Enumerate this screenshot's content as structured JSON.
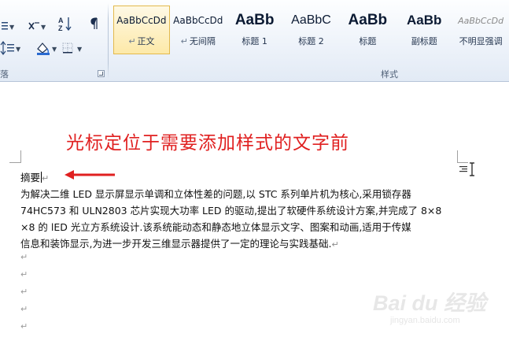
{
  "ribbon": {
    "paragraph_group_label": "落",
    "styles_group_label": "样式",
    "paragraph_tools": [
      {
        "name": "bullets-icon"
      },
      {
        "name": "text-direction-icon"
      },
      {
        "name": "sort-icon"
      },
      {
        "name": "show-formatting-marks-icon"
      },
      {
        "name": "line-spacing-icon"
      },
      {
        "name": "shading-icon"
      },
      {
        "name": "borders-icon"
      }
    ],
    "styles": [
      {
        "sample": "AaBbCcDd",
        "name": "正文",
        "mark": "↵",
        "selected": true
      },
      {
        "sample": "AaBbCcDd",
        "name": "无间隔",
        "mark": "↵",
        "selected": false
      },
      {
        "sample": "AaBb",
        "name": "标题 1",
        "mark": "",
        "selected": false
      },
      {
        "sample": "AaBbC",
        "name": "标题 2",
        "mark": "",
        "selected": false
      },
      {
        "sample": "AaBb",
        "name": "标题",
        "mark": "",
        "selected": false
      },
      {
        "sample": "AaBb",
        "name": "副标题",
        "mark": "",
        "selected": false
      },
      {
        "sample": "AaBbCcDd",
        "name": "不明显强调",
        "mark": "",
        "selected": false
      }
    ]
  },
  "document": {
    "annotation": "光标定位于需要添加样式的文字前",
    "heading_text": "摘要",
    "body_lines": [
      "为解决二维 LED 显示屏显示单调和立体性差的问题,以 STC 系列单片机为核心,采用锁存器",
      "74HC573 和 ULN2803 芯片实现大功率 LED 的驱动,提出了软硬件系统设计方案,并完成了 8×8",
      "×8 的 lED 光立方系统设计.该系统能动态和静态地立体显示文字、图案和动画,适用于传媒",
      "信息和装饰显示,为进一步开发三维显示器提供了一定的理论与实践基础."
    ],
    "paragraph_mark": "↵"
  },
  "watermark": {
    "text": "Bai du 经验",
    "sub": "jingyan.baidu.com"
  },
  "colors": {
    "annotation": "#e02020",
    "arrow": "#e02020",
    "selected_style_bg": "#fde9a8"
  }
}
